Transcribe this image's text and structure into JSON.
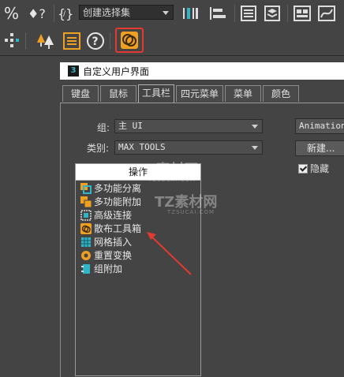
{
  "toolbar": {
    "selection_set_placeholder": "创建选择集"
  },
  "dialog": {
    "title": "自定义用户界面",
    "app_icon_label": "3",
    "tabs": [
      {
        "label": "键盘"
      },
      {
        "label": "鼠标"
      },
      {
        "label": "工具栏"
      },
      {
        "label": "四元菜单"
      },
      {
        "label": "菜单"
      },
      {
        "label": "颜色"
      }
    ],
    "active_tab": "工具栏",
    "group_label": "组:",
    "group_value": "主 UI",
    "category_label": "类别:",
    "category_value": "MAX TOOLS",
    "animation_select": "Animation",
    "new_button": "新建...",
    "hide_label": "隐藏",
    "hide_checked": true,
    "actions_header": "操作",
    "actions": [
      {
        "label": "多功能分离",
        "icon": "split-icon"
      },
      {
        "label": "多功能附加",
        "icon": "attach-icon"
      },
      {
        "label": "高级连接",
        "icon": "advanced-connect-icon"
      },
      {
        "label": "散布工具箱",
        "icon": "scatter-toolbox-icon"
      },
      {
        "label": "网格插入",
        "icon": "grid-insert-icon"
      },
      {
        "label": "重置变换",
        "icon": "reset-transform-icon"
      },
      {
        "label": "组附加",
        "icon": "group-attach-icon"
      }
    ]
  },
  "watermark": {
    "text": "TZ素材网",
    "sub": "TZSUCAI.COM"
  },
  "colors": {
    "highlight_red": "#e23a2e",
    "ui_bg": "#444444",
    "scatter_orange": "#f0a020"
  }
}
